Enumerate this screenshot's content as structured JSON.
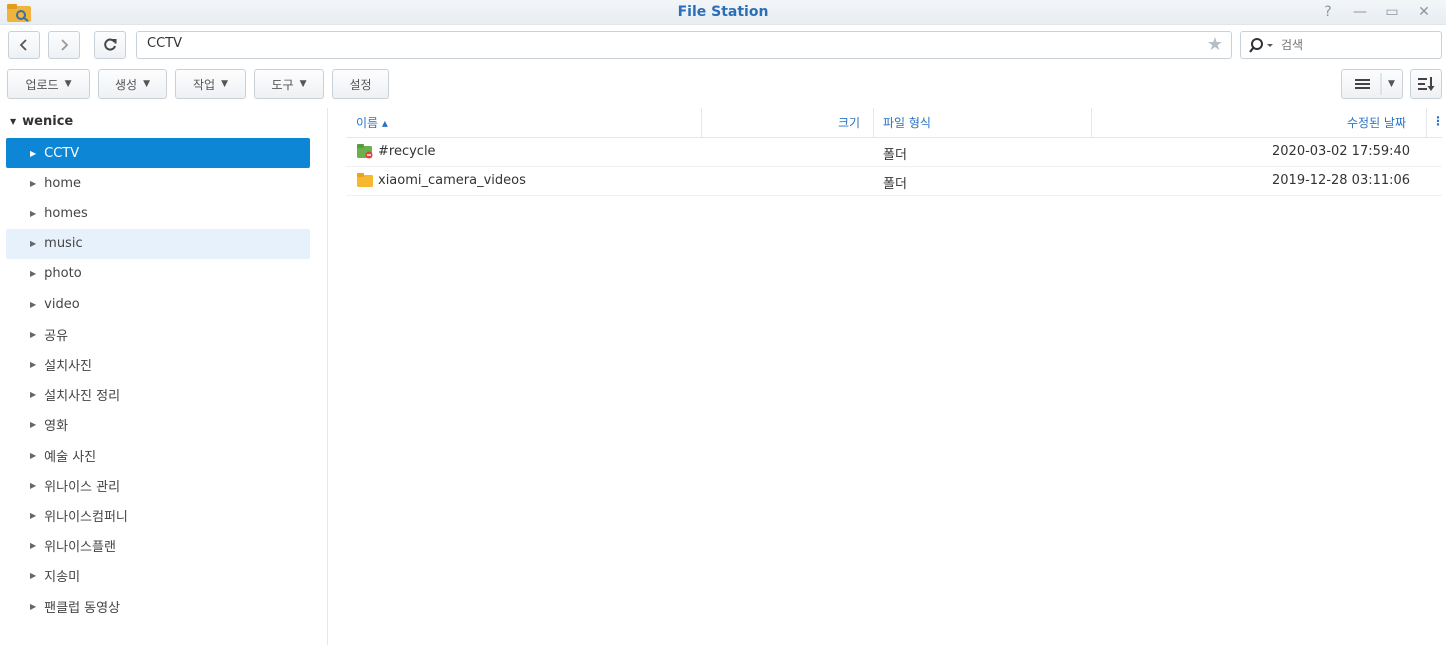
{
  "window": {
    "title": "File Station",
    "help_symbol": "?",
    "minimize_symbol": "—",
    "maximize_symbol": "▭",
    "close_symbol": "✕"
  },
  "nav": {
    "path": "CCTV",
    "search_placeholder": "검색"
  },
  "toolbar": {
    "upload": "업로드",
    "create": "생성",
    "action": "작업",
    "tools": "도구",
    "settings": "설정"
  },
  "sidebar": {
    "root": "wenice",
    "items": [
      {
        "label": "CCTV"
      },
      {
        "label": "home"
      },
      {
        "label": "homes"
      },
      {
        "label": "music"
      },
      {
        "label": "photo"
      },
      {
        "label": "video"
      },
      {
        "label": "공유"
      },
      {
        "label": "설치사진"
      },
      {
        "label": "설치사진 정리"
      },
      {
        "label": "영화"
      },
      {
        "label": "예술 사진"
      },
      {
        "label": "위나이스 관리"
      },
      {
        "label": "위나이스컴퍼니"
      },
      {
        "label": "위나이스플랜"
      },
      {
        "label": "지송미"
      },
      {
        "label": "팬클럽 동영상"
      }
    ],
    "selected_index": 0,
    "hover_index": 3
  },
  "list": {
    "columns": {
      "name": "이름 ▴",
      "size": "크기",
      "type": "파일 형식",
      "modified": "수정된 날짜"
    },
    "rows": [
      {
        "name": "#recycle",
        "size": "",
        "type": "폴더",
        "modified": "2020-03-02 17:59:40",
        "icon": "recycle-folder-icon"
      },
      {
        "name": "xiaomi_camera_videos",
        "size": "",
        "type": "폴더",
        "modified": "2019-12-28 03:11:06",
        "icon": "folder-icon"
      }
    ]
  },
  "colors": {
    "accent": "#0e86d6",
    "title": "#2a6fb8",
    "header_text": "#2a74c5",
    "folder": "#f5b82e"
  }
}
